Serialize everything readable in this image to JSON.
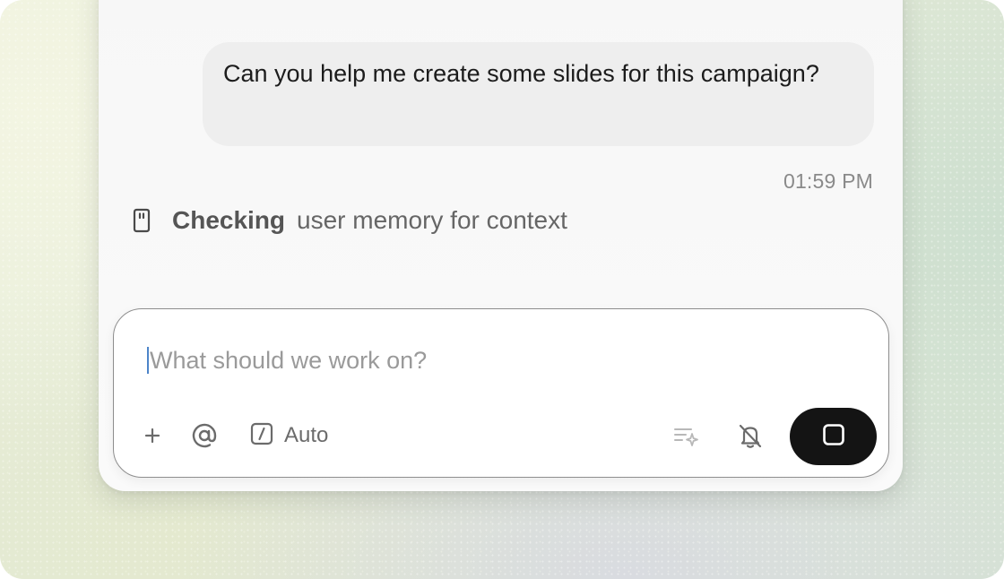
{
  "conversation": {
    "user_message": {
      "text": "Can you help me create some slides for this campaign?",
      "time": "01:59 PM"
    },
    "status": {
      "verb": "Checking",
      "detail": "user memory for context",
      "icon": "memory-card-icon"
    }
  },
  "composer": {
    "placeholder": "What should we work on?",
    "tools": {
      "add_icon": "plus-icon",
      "mention_icon": "at-sign-icon",
      "model_icon": "slash-command-icon",
      "model_label": "Auto",
      "enhance_icon": "sparkle-list-icon",
      "notify_icon": "bell-off-icon",
      "stop_icon": "stop-square-icon"
    }
  },
  "colors": {
    "stop_button": "#141414",
    "bubble": "#eeeeee",
    "caret": "#4d84c9"
  }
}
